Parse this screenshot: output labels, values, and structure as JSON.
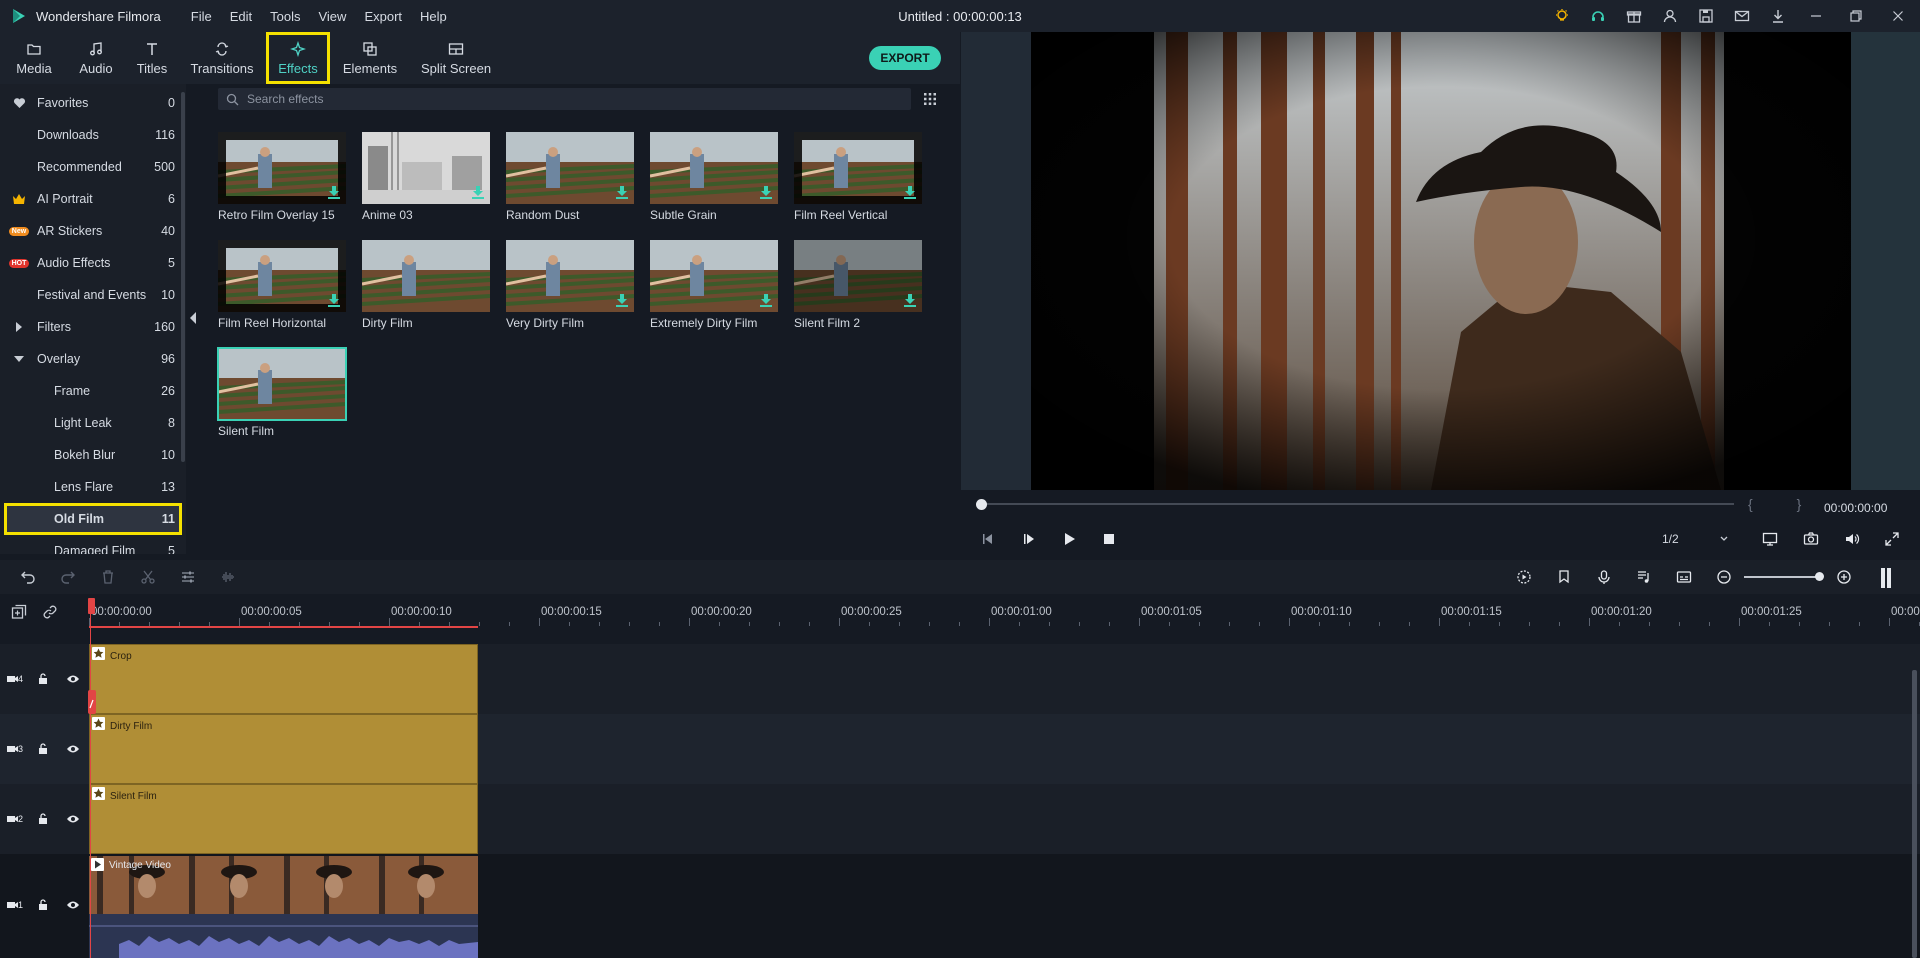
{
  "app": {
    "name": "Wondershare Filmora",
    "document_title": "Untitled : 00:00:00:13"
  },
  "menu": [
    "File",
    "Edit",
    "Tools",
    "View",
    "Export",
    "Help"
  ],
  "title_icons": [
    "bulb-icon",
    "headset-icon",
    "gift-icon",
    "account-icon",
    "save-icon",
    "mail-icon",
    "download-icon",
    "minimize-icon",
    "restore-icon",
    "close-icon"
  ],
  "tabs": [
    {
      "label": "Media",
      "icon": "folder-icon"
    },
    {
      "label": "Audio",
      "icon": "music-note-icon"
    },
    {
      "label": "Titles",
      "icon": "text-icon"
    },
    {
      "label": "Transitions",
      "icon": "transition-icon"
    },
    {
      "label": "Effects",
      "icon": "sparkle-icon",
      "active": true
    },
    {
      "label": "Elements",
      "icon": "elements-icon"
    },
    {
      "label": "Split Screen",
      "icon": "split-screen-icon"
    }
  ],
  "export_label": "EXPORT",
  "sidebar": {
    "items": [
      {
        "label": "Favorites",
        "count": "0",
        "icon": "heart-icon"
      },
      {
        "label": "Downloads",
        "count": "116"
      },
      {
        "label": "Recommended",
        "count": "500"
      },
      {
        "label": "AI Portrait",
        "count": "6",
        "icon": "crown-icon"
      },
      {
        "label": "AR Stickers",
        "count": "40",
        "badge": "New"
      },
      {
        "label": "Audio Effects",
        "count": "5",
        "badge": "HOT"
      },
      {
        "label": "Festival and Events",
        "count": "10"
      },
      {
        "label": "Filters",
        "count": "160",
        "icon": "caret-right-icon"
      },
      {
        "label": "Overlay",
        "count": "96",
        "icon": "caret-down-icon"
      },
      {
        "label": "Frame",
        "count": "26",
        "sub": true
      },
      {
        "label": "Light Leak",
        "count": "8",
        "sub": true
      },
      {
        "label": "Bokeh Blur",
        "count": "10",
        "sub": true
      },
      {
        "label": "Lens Flare",
        "count": "13",
        "sub": true
      },
      {
        "label": "Old Film",
        "count": "11",
        "sub": true,
        "selected": true
      },
      {
        "label": "Damaged Film",
        "count": "5",
        "sub": true
      }
    ]
  },
  "search": {
    "placeholder": "Search effects"
  },
  "effects": [
    {
      "label": "Retro Film Overlay 15",
      "style": "dark",
      "download": true
    },
    {
      "label": "Anime 03",
      "style": "sketch",
      "download": true
    },
    {
      "label": "Random Dust",
      "style": "color",
      "download": true
    },
    {
      "label": "Subtle Grain",
      "style": "color",
      "download": true
    },
    {
      "label": "Film Reel Vertical",
      "style": "dark",
      "download": true
    },
    {
      "label": "Film Reel Horizontal",
      "style": "dark",
      "download": true
    },
    {
      "label": "Dirty Film",
      "style": "color",
      "download": false
    },
    {
      "label": "Very Dirty Film",
      "style": "color",
      "download": true
    },
    {
      "label": "Extremely Dirty Film",
      "style": "color",
      "download": true
    },
    {
      "label": "Silent Film 2",
      "style": "dim",
      "download": true
    },
    {
      "label": "Silent Film",
      "style": "color",
      "download": false,
      "selected": true
    }
  ],
  "preview": {
    "time": "00:00:00:00",
    "quality": "1/2",
    "brackets": "{ }"
  },
  "ruler": [
    "00:00:00:00",
    "00:00:00:05",
    "00:00:00:10",
    "00:00:00:15",
    "00:00:00:20",
    "00:00:00:25",
    "00:00:01:00",
    "00:00:01:05",
    "00:00:01:10",
    "00:00:01:15",
    "00:00:01:20",
    "00:00:01:25",
    "00:00:0"
  ],
  "tracks": [
    {
      "number": "4",
      "clip": "Crop"
    },
    {
      "number": "3",
      "clip": "Dirty Film"
    },
    {
      "number": "2",
      "clip": "Silent Film"
    },
    {
      "number": "1",
      "clip": "Vintage Video"
    }
  ],
  "colors": {
    "accent": "#3ad1b5",
    "highlight": "#f5e100",
    "effect_clip": "#b08e36",
    "playhead": "#e24545"
  }
}
